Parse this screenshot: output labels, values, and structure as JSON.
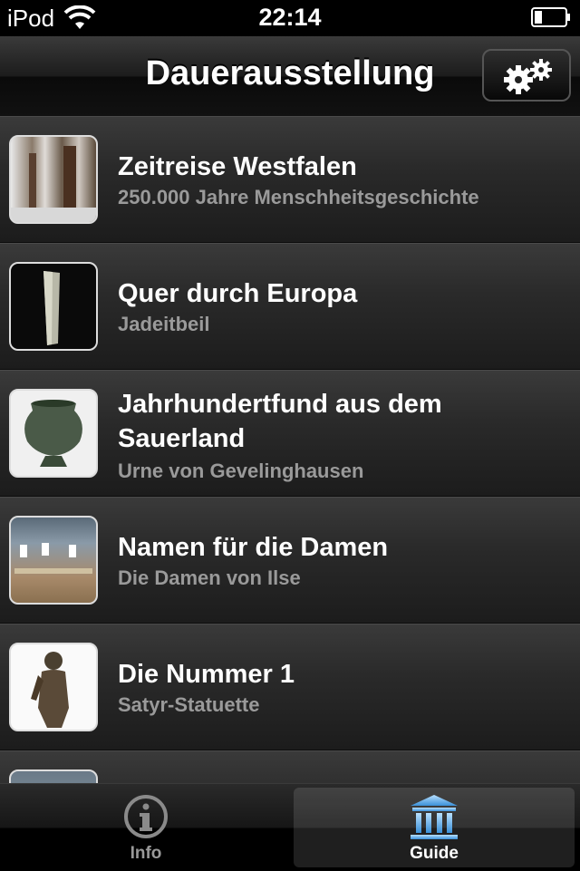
{
  "status_bar": {
    "carrier": "iPod",
    "time": "22:14"
  },
  "nav": {
    "title": "Dauerausstellung",
    "settings_icon": "gear-icon"
  },
  "list": {
    "items": [
      {
        "title": "Zeitreise Westfalen",
        "subtitle": "250.000 Jahre Menschheitsgeschichte"
      },
      {
        "title": "Quer durch Europa",
        "subtitle": "Jadeitbeil"
      },
      {
        "title": "Jahrhundertfund aus dem Sauerland",
        "subtitle": "Urne von Gevelinghausen"
      },
      {
        "title": "Namen für die Damen",
        "subtitle": "Die Damen von Ilse"
      },
      {
        "title": "Die Nummer 1",
        "subtitle": "Satyr-Statuette"
      }
    ]
  },
  "tabbar": {
    "tabs": [
      {
        "label": "Info",
        "icon": "info-icon",
        "selected": false
      },
      {
        "label": "Guide",
        "icon": "museum-icon",
        "selected": true
      }
    ]
  },
  "colors": {
    "accent_tab_icon": "#7fbff0",
    "subtitle": "#9a9a9a"
  }
}
